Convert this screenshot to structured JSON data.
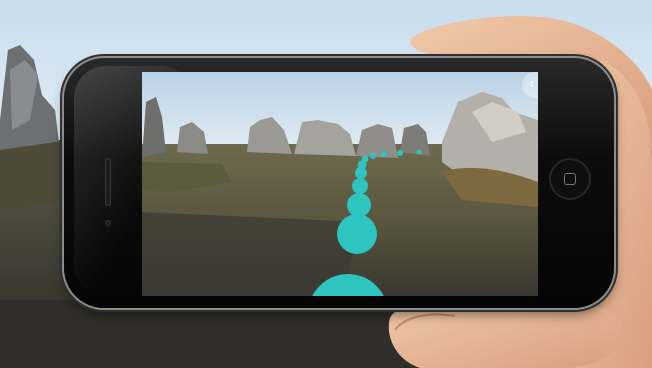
{
  "scene": {
    "description_label": "",
    "ar_path_color": "#2ec4c0",
    "ar_path_highlight": "#5fd9d4"
  },
  "phone": {
    "nav_icon": "chevron-left-icon",
    "nav_glyph": "‹",
    "home_icon": "home-square-icon"
  }
}
